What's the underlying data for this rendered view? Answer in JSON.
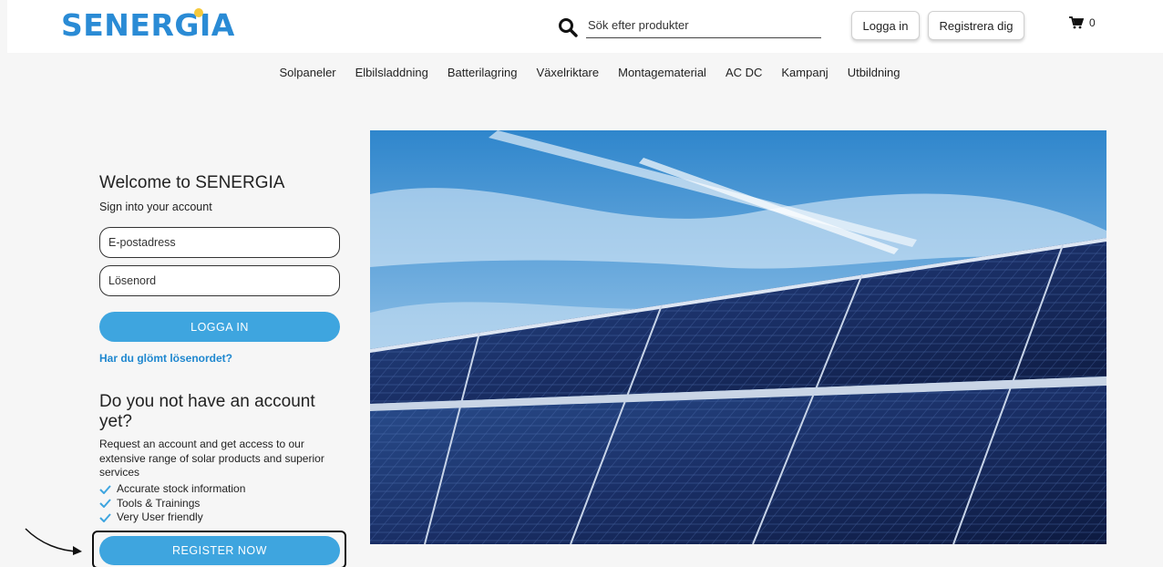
{
  "header": {
    "logo": "SENERGIA",
    "search_placeholder": "Sök efter produkter",
    "login_label": "Logga in",
    "register_label": "Registrera dig",
    "cart_count": "0"
  },
  "nav": [
    "Solpaneler",
    "Elbilsladdning",
    "Batterilagring",
    "Växelriktare",
    "Montagematerial",
    "AC DC",
    "Kampanj",
    "Utbildning"
  ],
  "signin": {
    "title": "Welcome to SENERGIA",
    "subtitle": "Sign into your account",
    "email_placeholder": "E-postadress",
    "password_placeholder": "Lösenord",
    "login_button": "LOGGA IN",
    "forgot_link": "Har du glömt lösenordet?"
  },
  "signup": {
    "title": "Do you not have an account yet?",
    "description": "Request an account and get access to our extensive range of solar products and superior services",
    "benefits": [
      "Accurate stock information",
      "Tools & Trainings",
      "Very User friendly"
    ],
    "register_button": "REGISTER NOW"
  },
  "colors": {
    "brand": "#2a8bd5",
    "accent": "#3ea5df",
    "link": "#1e87cf",
    "logo_dot": "#f6c93b"
  },
  "icons": {
    "search": "search-icon",
    "cart": "cart-icon",
    "check": "check-icon",
    "arrow": "arrow-icon"
  }
}
